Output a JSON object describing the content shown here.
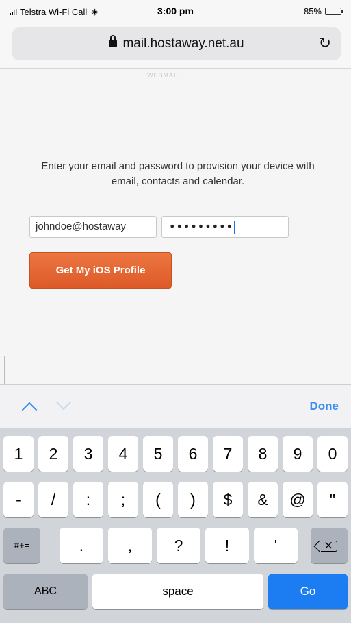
{
  "status_bar": {
    "carrier": "Telstra Wi-Fi Call",
    "time": "3:00 pm",
    "battery": "85%",
    "battery_level": 0.85
  },
  "browser": {
    "url": "mail.hostaway.net.au"
  },
  "page": {
    "logo_text": "WEBMAIL",
    "instructions": "Enter your email and password to provision your device with email, contacts and calendar.",
    "email_value": "johndoe@hostaway",
    "password_value": "•••••••••",
    "submit_label": "Get My iOS Profile"
  },
  "accessory_bar": {
    "done_label": "Done"
  },
  "keyboard": {
    "row1": [
      "1",
      "2",
      "3",
      "4",
      "5",
      "6",
      "7",
      "8",
      "9",
      "0"
    ],
    "row2": [
      "-",
      "/",
      ":",
      ";",
      "(",
      ")",
      "$",
      "&",
      "@",
      "\""
    ],
    "row3_mode": "#+=",
    "row3": [
      ".",
      ",",
      "?",
      "!",
      "'"
    ],
    "abc_label": "ABC",
    "space_label": "space",
    "go_label": "Go"
  },
  "icons": [
    "signal-icon",
    "wifi-icon",
    "battery-icon",
    "lock-icon",
    "reload-icon",
    "chevron-up-icon",
    "chevron-down-icon",
    "backspace-icon"
  ]
}
